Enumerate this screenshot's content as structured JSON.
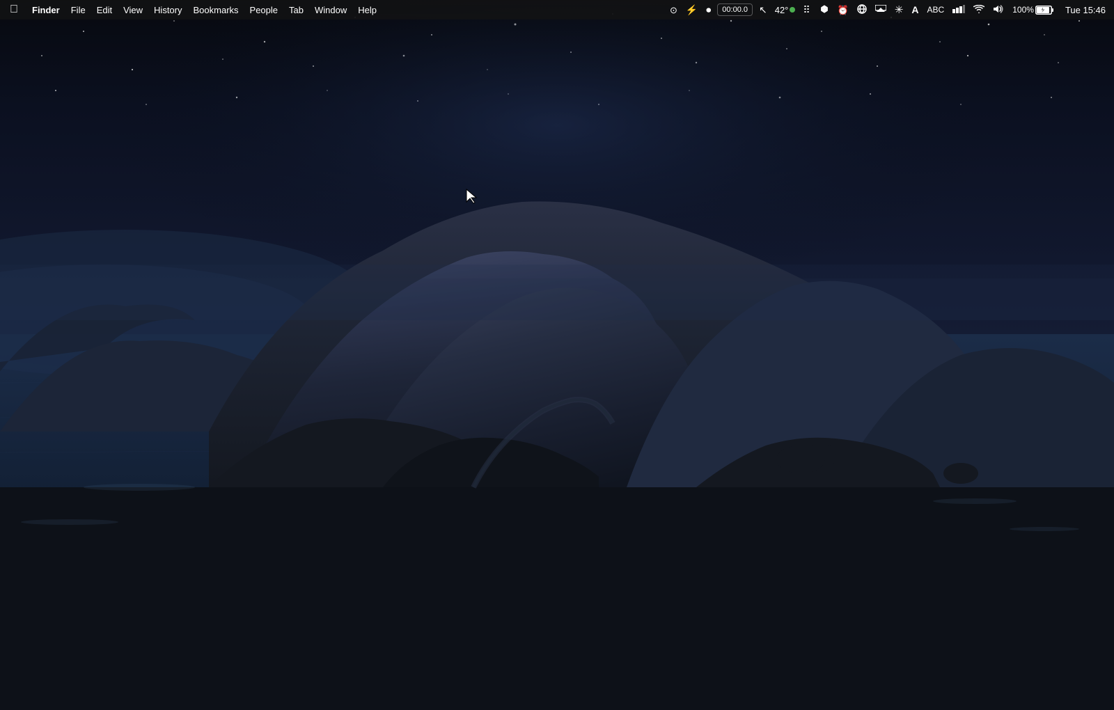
{
  "menubar": {
    "apple_symbol": "⌘",
    "app_name": "Finder",
    "menus": [
      {
        "label": "File",
        "id": "file"
      },
      {
        "label": "Edit",
        "id": "edit"
      },
      {
        "label": "View",
        "id": "view"
      },
      {
        "label": "History",
        "id": "history"
      },
      {
        "label": "Bookmarks",
        "id": "bookmarks"
      },
      {
        "label": "People",
        "id": "people"
      },
      {
        "label": "Tab",
        "id": "tab"
      },
      {
        "label": "Window",
        "id": "window"
      },
      {
        "label": "Help",
        "id": "help"
      }
    ]
  },
  "statusbar": {
    "timer": "00:00.0",
    "temperature": "42°",
    "wifi_signal": "WiFi",
    "volume": "Volume",
    "battery_pct": "100%",
    "clock": "Tue 15:46",
    "icons": [
      {
        "name": "autofocus-icon",
        "symbol": "⊙"
      },
      {
        "name": "flash-icon",
        "symbol": "⚡"
      },
      {
        "name": "record-icon",
        "symbol": "⏺"
      },
      {
        "name": "cursor-icon",
        "symbol": "↖"
      },
      {
        "name": "temp-icon",
        "symbol": "42°"
      },
      {
        "name": "dotgrid-icon",
        "symbol": "⠿"
      },
      {
        "name": "dropbox-icon",
        "symbol": "📦"
      },
      {
        "name": "alarm-icon",
        "symbol": "⏰"
      },
      {
        "name": "browser-icon",
        "symbol": "🔵"
      },
      {
        "name": "screencast-icon",
        "symbol": "▶"
      },
      {
        "name": "sparkle-icon",
        "symbol": "✦"
      },
      {
        "name": "text-a-icon",
        "symbol": "A"
      },
      {
        "name": "abc-icon",
        "symbol": "ABC"
      },
      {
        "name": "battery-bars-icon",
        "symbol": "▌▌▌"
      },
      {
        "name": "wifi-icon",
        "symbol": "▲"
      },
      {
        "name": "volume-icon",
        "symbol": "🔊"
      },
      {
        "name": "battery-pct-label",
        "symbol": "100%"
      },
      {
        "name": "charging-icon",
        "symbol": "⚡"
      }
    ]
  },
  "desktop": {
    "wallpaper_description": "macOS Catalina dark wallpaper - island mountain at night with dark blue ocean"
  }
}
